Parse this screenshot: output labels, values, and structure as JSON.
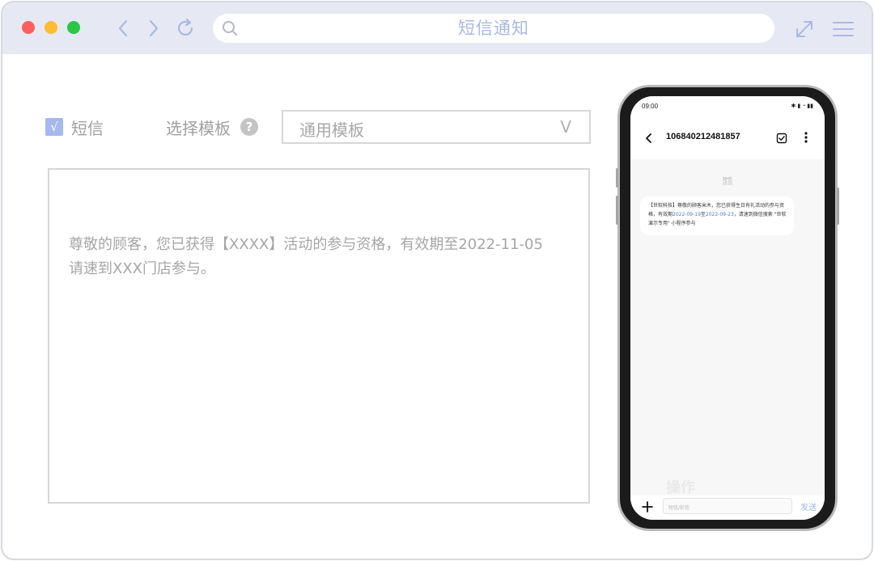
{
  "window": {
    "title": "短信通知"
  },
  "form": {
    "sms_checkbox_mark": "√",
    "sms_label": "短信",
    "template_label": "选择模板",
    "help_mark": "?",
    "template_selected": "通用模板",
    "template_chevron": "V",
    "message_line1": "尊敬的顾客，您已获得【XXXX】活动的参与资格，有效期至2022-11-05",
    "message_line2": "请速到XXX门店参与。"
  },
  "phone": {
    "status_time": "09:00",
    "sender_number": "106840212481857",
    "message_label": "短信",
    "message_time": "09:00",
    "bubble": {
      "part1": "【世软科技】尊敬的顾客米木，您已获得生日有礼活动的参与资格，有效期",
      "date_start": "2022-09-19",
      "separator": "至",
      "date_end": "2022-09-23",
      "part2": "，请速到微信搜索 \"世软演示专用\" 小程序参与"
    },
    "action_watermark": "操作",
    "input_placeholder": "短信/彩信",
    "send_label": "发送"
  },
  "colors": {
    "titlebar": "#e6e9f4",
    "accent": "#a9b8e6",
    "checkbox": "#a6b8f0",
    "link_blue": "#4a7bd8"
  },
  "icons": {
    "back": "chevron-left-icon",
    "forward": "chevron-right-icon",
    "reload": "reload-icon",
    "search": "search-icon",
    "expand": "expand-icon",
    "menu": "menu-icon"
  }
}
